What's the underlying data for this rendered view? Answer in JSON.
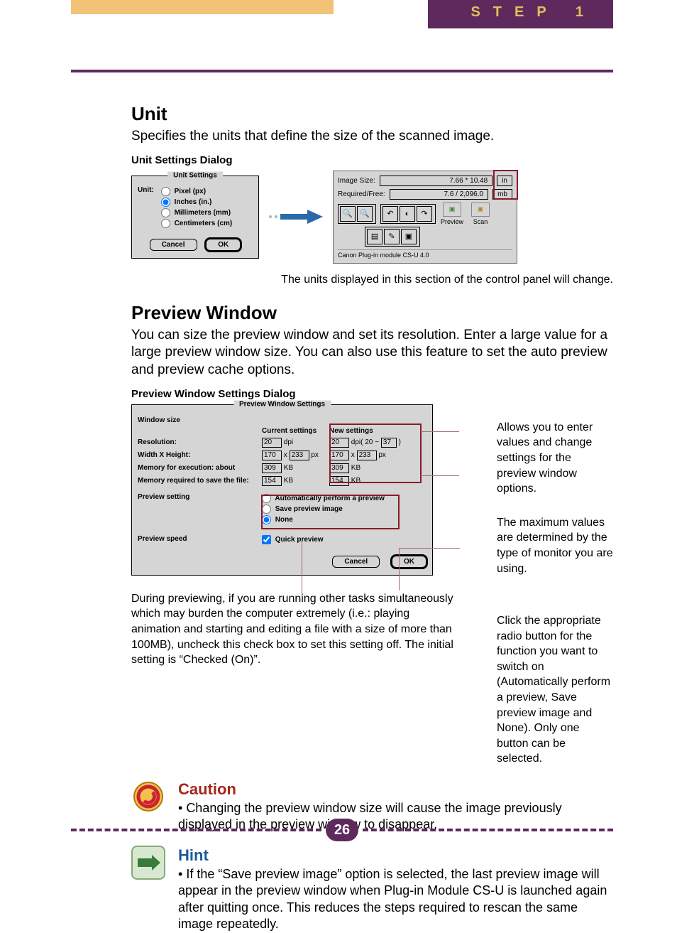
{
  "header": {
    "step_label": "STEP 1"
  },
  "unit": {
    "heading": "Unit",
    "desc": "Specifies the units that define the size of the scanned image.",
    "dialog_title_label": "Unit Settings Dialog",
    "dialog": {
      "title": "Unit Settings",
      "field_label": "Unit:",
      "options": [
        "Pixel (px)",
        "Inches (in.)",
        "Millimeters (mm)",
        "Centimeters (cm)"
      ],
      "cancel": "Cancel",
      "ok": "OK"
    },
    "panel": {
      "image_size_label": "Image Size:",
      "image_size_value": "7.66 * 10.48",
      "image_size_unit": "in",
      "required_label": "Required/Free:",
      "required_value": "7.6 / 2,096.0",
      "required_unit": "mb",
      "preview_btn": "Preview",
      "scan_btn": "Scan",
      "footer": "Canon Plug-in module CS-U 4.0"
    },
    "caption": "The units displayed in this section of the control panel will change."
  },
  "preview": {
    "heading": "Preview Window",
    "desc": "You can size the preview window and set its resolution. Enter a large value for a large preview window size. You can also use this feature to set the auto preview and preview cache options.",
    "dialog_title_label": "Preview Window Settings Dialog",
    "dialog": {
      "title": "Preview Window Settings",
      "rows": {
        "window_size": "Window size",
        "current": "Current settings",
        "new": "New settings",
        "resolution": "Resolution:",
        "wxh": "Width X Height:",
        "mem_exec": "Memory for execution: about",
        "mem_save": "Memory required to save the file:",
        "preview_setting": "Preview setting",
        "preview_speed": "Preview speed"
      },
      "vals": {
        "res_cur": "20",
        "res_cur_u": "dpi",
        "w_cur": "170",
        "h_cur": "233",
        "wxh_u": "px",
        "mem_exec_cur": "309",
        "kb": "KB",
        "mem_save_cur": "154",
        "res_new": "20",
        "res_new_u": "dpi(",
        "res_range_a": "20",
        "tilde": "~",
        "res_range_b": "37",
        "close": ")",
        "w_new": "170",
        "h_new": "233",
        "mem_exec_new": "309",
        "mem_save_new": "154"
      },
      "radio": {
        "auto": "Automatically perform a preview",
        "save": "Save preview image",
        "none": "None"
      },
      "quick": "Quick preview",
      "cancel": "Cancel",
      "ok": "OK"
    },
    "note1": "Allows you to enter values and change settings for the preview window options.",
    "note2": "The maximum values are determined by the type of monitor you are using.",
    "note3": "Click the appropriate radio button for the function you want to switch on (Automatically perform a preview, Save preview image and None). Only one button can be selected.",
    "below": "During previewing, if you are running other tasks simultaneously which may burden the computer extremely (i.e.: playing animation and starting and editing a file with a size of more than 100MB), uncheck this check box to set this setting off. The initial setting is “Checked (On)”."
  },
  "caution": {
    "title": "Caution",
    "text": "Changing the preview window size will cause the image previously displayed in the preview window to disappear."
  },
  "hint": {
    "title": "Hint",
    "text": "If the “Save preview image” option is selected, the last preview image will appear in the preview window when Plug-in Module CS-U is launched again after quitting once. This reduces the steps required to rescan the same image repeatedly."
  },
  "pagenum": "26"
}
